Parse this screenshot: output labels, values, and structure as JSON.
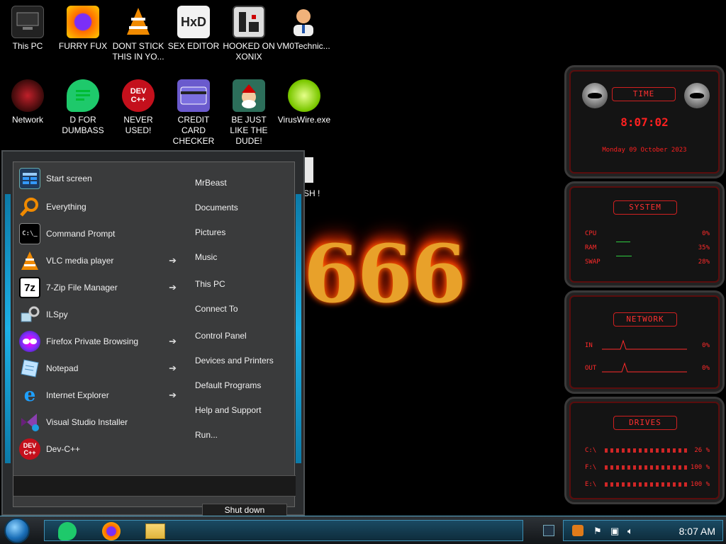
{
  "desktop": {
    "icons": [
      {
        "label": "This PC"
      },
      {
        "label": "FURRY FUX"
      },
      {
        "label": "DONT STICK THIS IN YO..."
      },
      {
        "label": "SEX EDITOR"
      },
      {
        "label": "HOOKED ON XONIX"
      },
      {
        "label": "VM0Technic..."
      },
      {
        "label": "Network"
      },
      {
        "label": "D FOR DUMBASS"
      },
      {
        "label": "NEVER USED!"
      },
      {
        "label": "CREDIT CARD CHECKER"
      },
      {
        "label": "BE JUST LIKE THE DUDE!"
      },
      {
        "label": "VirusWire.exe"
      }
    ],
    "partial_icon_label": "SH !",
    "wallpaper_text": "666"
  },
  "start_menu": {
    "programs": [
      {
        "label": "Start screen",
        "icon": "start-screen-icon",
        "arrow": ""
      },
      {
        "label": "Everything",
        "icon": "magnifier-icon",
        "arrow": ""
      },
      {
        "label": "Command Prompt",
        "icon": "cmd-icon",
        "arrow": ""
      },
      {
        "label": "VLC media player",
        "icon": "vlc-cone-icon",
        "arrow": "➔"
      },
      {
        "label": "7-Zip File Manager",
        "icon": "7zip-icon",
        "arrow": "➔"
      },
      {
        "label": "ILSpy",
        "icon": "ilspy-icon",
        "arrow": ""
      },
      {
        "label": "Firefox Private Browsing",
        "icon": "firefox-private-icon",
        "arrow": "➔"
      },
      {
        "label": "Notepad",
        "icon": "notepad-icon",
        "arrow": "➔"
      },
      {
        "label": "Internet Explorer",
        "icon": "ie-icon",
        "arrow": "➔"
      },
      {
        "label": "Visual Studio Installer",
        "icon": "vs-installer-icon",
        "arrow": ""
      },
      {
        "label": "Dev-C++",
        "icon": "devcpp-icon",
        "arrow": ""
      }
    ],
    "links": [
      "MrBeast",
      "Documents",
      "Pictures",
      "Music",
      "This PC",
      "Connect To",
      "Control Panel",
      "Devices and Printers",
      "Default Programs",
      "Help and Support",
      "Run..."
    ],
    "shutdown_label": "Shut down",
    "icon_text": {
      "seven_zip": "7z",
      "dev": "DEV",
      "cpp": "C++",
      "ie": "e",
      "cmd": "C:\\_"
    }
  },
  "gadgets": {
    "time": {
      "title": "TIME",
      "clock": "8:07:02",
      "date": "Monday 09 October 2023"
    },
    "system": {
      "title": "SYSTEM",
      "rows": [
        {
          "label": "CPU",
          "value": "0%"
        },
        {
          "label": "RAM",
          "value": "35%"
        },
        {
          "label": "SWAP",
          "value": "28%"
        }
      ]
    },
    "network": {
      "title": "NETWORK",
      "rows": [
        {
          "label": "IN",
          "value": "0%"
        },
        {
          "label": "OUT",
          "value": "0%"
        }
      ]
    },
    "drives": {
      "title": "DRIVES",
      "rows": [
        {
          "label": "C:\\",
          "value": "26 %"
        },
        {
          "label": "F:\\",
          "value": "100 %"
        },
        {
          "label": "E:\\",
          "value": "100 %"
        }
      ]
    }
  },
  "taskbar": {
    "pinned": [
      "notes-app-icon",
      "firefox-icon",
      "file-explorer-icon"
    ],
    "clock": "8:07 AM"
  },
  "colors": {
    "accent": "#1db0e6",
    "gadget_red": "#ff2a2a",
    "fire": "#e8a12a"
  }
}
